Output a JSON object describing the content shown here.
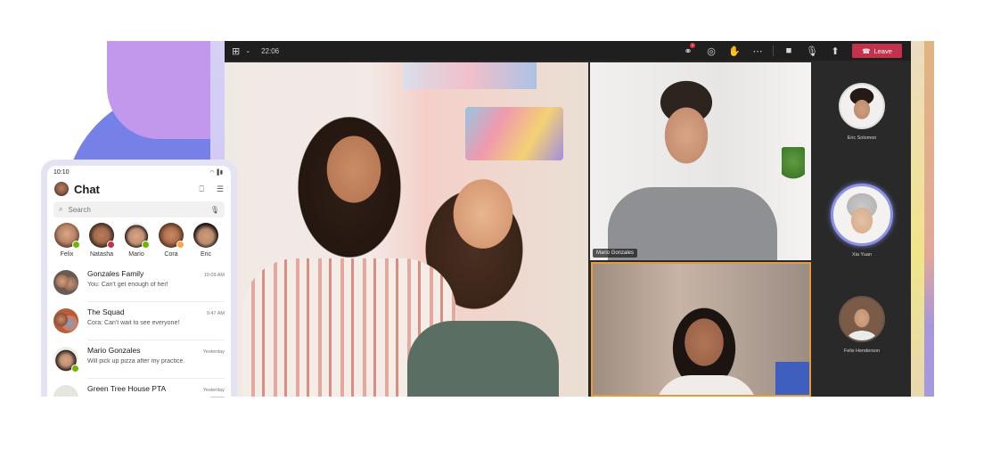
{
  "meeting": {
    "toolbar": {
      "layout_icon": "grid-layout-icon",
      "clock": "22:06",
      "participants_badge": "1",
      "buttons": [
        {
          "name": "participants",
          "icon": "people-icon"
        },
        {
          "name": "chat",
          "icon": "chat-bubble-icon"
        },
        {
          "name": "raise-hand",
          "icon": "hand-icon"
        },
        {
          "name": "more",
          "icon": "ellipsis-icon"
        },
        {
          "name": "camera",
          "icon": "video-camera-icon"
        },
        {
          "name": "microphone",
          "icon": "microphone-icon"
        },
        {
          "name": "share",
          "icon": "share-screen-icon"
        }
      ],
      "leave_label": "Leave"
    },
    "tiles": [
      {
        "label": "Mario Gonzales"
      }
    ],
    "rail": [
      {
        "name": "Eric Solomon"
      },
      {
        "name": "Xia Yuan",
        "speaking": true
      },
      {
        "name": "Felix Henderson"
      }
    ],
    "colors": {
      "leave": "#c4314b",
      "active_speaker": "#e69a3c",
      "rail_highlight": "#8d91e6"
    }
  },
  "phone": {
    "status_time": "10:10",
    "status_icons": "wifi-signal-battery",
    "title": "Chat",
    "search_placeholder": "Search",
    "contacts": [
      {
        "name": "Felix",
        "status": "available"
      },
      {
        "name": "Natasha",
        "status": "busy"
      },
      {
        "name": "Mario",
        "status": "available"
      },
      {
        "name": "Cora",
        "status": "away"
      },
      {
        "name": "Eric",
        "status": ""
      }
    ],
    "chats": [
      {
        "name": "Gonzales Family",
        "time": "10:09 AM",
        "preview": "You: Can't get enough of her!"
      },
      {
        "name": "The Squad",
        "time": "9:47 AM",
        "preview": "Cora: Can't wait to see everyone!"
      },
      {
        "name": "Mario Gonzales",
        "time": "Yesterday",
        "preview": "Will pick up pizza after my practice."
      },
      {
        "name": "Green Tree House PTA",
        "time": "Yesterday",
        "preview": ""
      }
    ],
    "status_colors": {
      "available": "#6bb700",
      "busy": "#c4314b",
      "away": "#f8a53a"
    }
  }
}
